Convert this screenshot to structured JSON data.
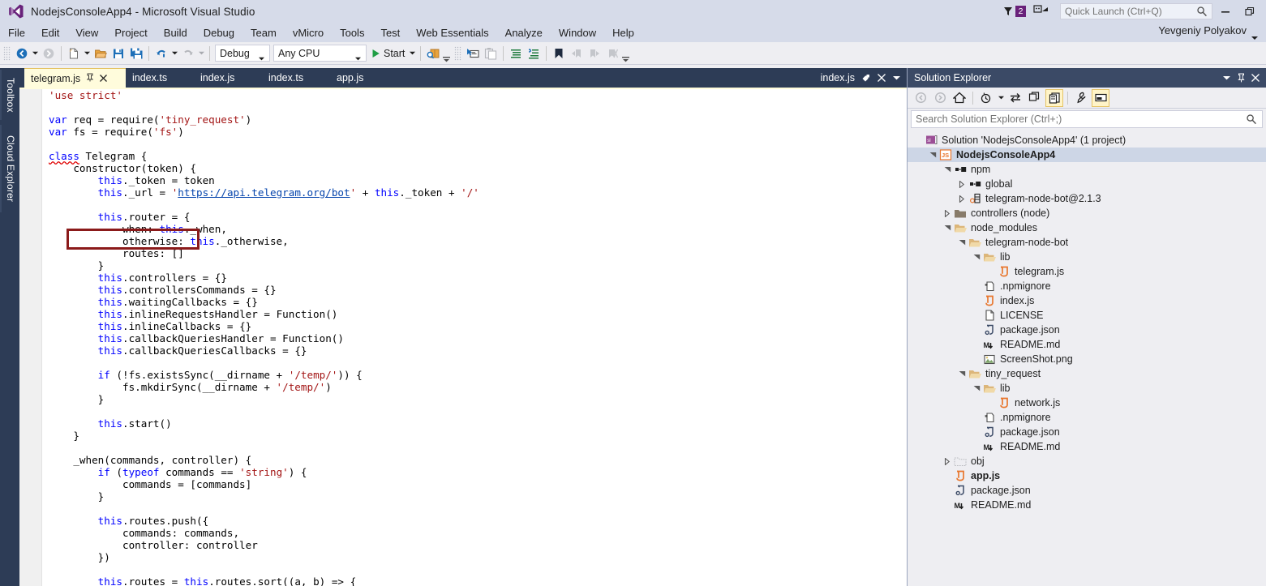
{
  "window": {
    "title": "NodejsConsoleApp4 - Microsoft Visual Studio",
    "logo_icon": "visual-studio-logo",
    "minimize_label": "–",
    "restore_label": "❐",
    "notification_count": "2",
    "feedback_icon": "feedback-icon",
    "user": "Yevgeniy Polyakov"
  },
  "quick_launch": {
    "placeholder": "Quick Launch (Ctrl+Q)",
    "value": "",
    "icon": "search-icon"
  },
  "menu": {
    "items": [
      {
        "label": "File"
      },
      {
        "label": "Edit"
      },
      {
        "label": "View"
      },
      {
        "label": "Project"
      },
      {
        "label": "Build"
      },
      {
        "label": "Debug"
      },
      {
        "label": "Team"
      },
      {
        "label": "vMicro"
      },
      {
        "label": "Tools"
      },
      {
        "label": "Test"
      },
      {
        "label": "Web Essentials"
      },
      {
        "label": "Analyze"
      },
      {
        "label": "Window"
      },
      {
        "label": "Help"
      }
    ]
  },
  "toolbar": {
    "navigate_back": "navigate-back-icon",
    "navigate_forward": "navigate-forward-icon",
    "new_project": "new-project-icon",
    "open_file": "open-file-icon",
    "save": "save-icon",
    "save_all": "save-all-icon",
    "undo": "undo-icon",
    "redo": "redo-icon",
    "config_value": "Debug",
    "platform_value": "Any CPU",
    "start_label": "Start",
    "start_icon": "play-icon",
    "find_in_files": "find-in-files-icon",
    "step_icons": [
      "step-over-icon",
      "step-out-icon"
    ],
    "comment": "comment-icon",
    "uncomment": "uncomment-icon",
    "bookmark": "bookmark-icon",
    "prev_bookmark": "previous-bookmark-icon",
    "next_bookmark": "next-bookmark-icon",
    "clear_bookmarks": "clear-bookmarks-icon",
    "overflow": "toolbar-overflow-icon"
  },
  "left_rail": {
    "tabs": [
      {
        "label": "Toolbox"
      },
      {
        "label": "Cloud Explorer"
      }
    ]
  },
  "editor_tabs": {
    "tabs": [
      {
        "label": "telegram.js",
        "active": true,
        "pin_icon": "pin-icon",
        "close_icon": "close-icon"
      },
      {
        "label": "index.ts",
        "active": false
      },
      {
        "label": "index.js",
        "active": false
      },
      {
        "label": "index.ts",
        "active": false
      },
      {
        "label": "app.js",
        "active": false
      }
    ],
    "right": {
      "label": "index.js",
      "pin_icon": "pin-icon",
      "close_icon": "close-icon",
      "dropdown_icon": "chevron-down-icon"
    }
  },
  "editor": {
    "filename": "telegram.js",
    "annotation": {
      "shape": "rectangle",
      "color": "#8b1a1a",
      "targets": "class Telegram {"
    },
    "error_marker_color": "#f21d1d",
    "lines": [
      "'use strict'",
      "",
      "var req = require('tiny_request')",
      "var fs = require('fs')",
      "",
      "class Telegram {",
      "    constructor(token) {",
      "        this._token = token",
      "        this._url = 'https://api.telegram.org/bot' + this._token + '/'",
      "",
      "        this.router = {",
      "            when: this._when,",
      "            otherwise: this._otherwise,",
      "            routes: []",
      "        }",
      "        this.controllers = {}",
      "        this.controllersCommands = {}",
      "        this.waitingCallbacks = {}",
      "        this.inlineRequestsHandler = Function()",
      "        this.inlineCallbacks = {}",
      "        this.callbackQueriesHandler = Function()",
      "        this.callbackQueriesCallbacks = {}",
      "",
      "        if (!fs.existsSync(__dirname + '/temp/')) {",
      "            fs.mkdirSync(__dirname + '/temp/')",
      "        }",
      "",
      "        this.start()",
      "    }",
      "",
      "    _when(commands, controller) {",
      "        if (typeof commands == 'string') {",
      "            commands = [commands]",
      "        }",
      "",
      "        this.routes.push({",
      "            commands: commands,",
      "            controller: controller",
      "        })",
      "",
      "        this.routes = this.routes.sort((a, b) => {"
    ]
  },
  "solution_explorer": {
    "title": "Solution Explorer",
    "header_buttons": [
      {
        "icon": "chevron-down-icon",
        "glyph": "▾"
      },
      {
        "icon": "pin-icon",
        "glyph": "⚑"
      },
      {
        "icon": "close-icon",
        "glyph": "✕"
      }
    ],
    "toolbar": [
      {
        "icon": "back-icon",
        "toggled": false
      },
      {
        "icon": "forward-icon",
        "toggled": false
      },
      {
        "icon": "home-icon",
        "toggled": false
      },
      {
        "icon": "pending-changes-icon",
        "toggled": false
      },
      {
        "icon": "sync-with-active-document-icon",
        "toggled": false
      },
      {
        "icon": "refresh-icon",
        "toggled": false
      },
      {
        "icon": "show-all-files-icon",
        "toggled": true
      },
      {
        "icon": "properties-icon",
        "toggled": false
      },
      {
        "icon": "preview-selected-items-icon",
        "toggled": true
      }
    ],
    "search": {
      "placeholder": "Search Solution Explorer (Ctrl+;)",
      "value": "",
      "icon": "search-icon"
    },
    "tree": [
      {
        "depth": 0,
        "label": "Solution 'NodejsConsoleApp4' (1 project)",
        "icon": "solution-icon",
        "expander": "none",
        "selected": false,
        "bold": false
      },
      {
        "depth": 1,
        "label": "NodejsConsoleApp4",
        "icon": "js-project-icon",
        "expander": "expanded",
        "selected": true,
        "bold": true
      },
      {
        "depth": 2,
        "label": "npm",
        "icon": "npm-icon",
        "expander": "expanded",
        "selected": false,
        "bold": false
      },
      {
        "depth": 3,
        "label": "global",
        "icon": "npm-icon",
        "expander": "collapsed",
        "selected": false,
        "bold": false
      },
      {
        "depth": 3,
        "label": "telegram-node-bot@2.1.3",
        "icon": "npm-package-icon",
        "expander": "collapsed",
        "selected": false,
        "bold": false
      },
      {
        "depth": 2,
        "label": "controllers (node)",
        "icon": "folder-closed-icon",
        "expander": "collapsed",
        "selected": false,
        "bold": false
      },
      {
        "depth": 2,
        "label": "node_modules",
        "icon": "folder-open-icon",
        "expander": "expanded",
        "selected": false,
        "bold": false
      },
      {
        "depth": 3,
        "label": "telegram-node-bot",
        "icon": "folder-open-icon",
        "expander": "expanded",
        "selected": false,
        "bold": false
      },
      {
        "depth": 4,
        "label": "lib",
        "icon": "folder-open-icon",
        "expander": "expanded",
        "selected": false,
        "bold": false
      },
      {
        "depth": 5,
        "label": "telegram.js",
        "icon": "js-file-icon",
        "expander": "none",
        "selected": false,
        "bold": false
      },
      {
        "depth": 4,
        "label": ".npmignore",
        "icon": "config-file-icon",
        "expander": "none",
        "selected": false,
        "bold": false
      },
      {
        "depth": 4,
        "label": "index.js",
        "icon": "js-file-icon",
        "expander": "none",
        "selected": false,
        "bold": false
      },
      {
        "depth": 4,
        "label": "LICENSE",
        "icon": "text-file-icon",
        "expander": "none",
        "selected": false,
        "bold": false
      },
      {
        "depth": 4,
        "label": "package.json",
        "icon": "json-file-icon",
        "expander": "none",
        "selected": false,
        "bold": false
      },
      {
        "depth": 4,
        "label": "README.md",
        "icon": "markdown-file-icon",
        "expander": "none",
        "selected": false,
        "bold": false
      },
      {
        "depth": 4,
        "label": "ScreenShot.png",
        "icon": "image-file-icon",
        "expander": "none",
        "selected": false,
        "bold": false
      },
      {
        "depth": 3,
        "label": "tiny_request",
        "icon": "folder-open-icon",
        "expander": "expanded",
        "selected": false,
        "bold": false
      },
      {
        "depth": 4,
        "label": "lib",
        "icon": "folder-open-icon",
        "expander": "expanded",
        "selected": false,
        "bold": false
      },
      {
        "depth": 5,
        "label": "network.js",
        "icon": "js-file-icon",
        "expander": "none",
        "selected": false,
        "bold": false
      },
      {
        "depth": 4,
        "label": ".npmignore",
        "icon": "config-file-icon",
        "expander": "none",
        "selected": false,
        "bold": false
      },
      {
        "depth": 4,
        "label": "package.json",
        "icon": "json-file-icon",
        "expander": "none",
        "selected": false,
        "bold": false
      },
      {
        "depth": 4,
        "label": "README.md",
        "icon": "markdown-file-icon",
        "expander": "none",
        "selected": false,
        "bold": false
      },
      {
        "depth": 2,
        "label": "obj",
        "icon": "hidden-folder-icon",
        "expander": "collapsed",
        "selected": false,
        "bold": false
      },
      {
        "depth": 2,
        "label": "app.js",
        "icon": "js-file-icon",
        "expander": "none",
        "selected": false,
        "bold": true
      },
      {
        "depth": 2,
        "label": "package.json",
        "icon": "json-file-icon",
        "expander": "none",
        "selected": false,
        "bold": false
      },
      {
        "depth": 2,
        "label": "README.md",
        "icon": "markdown-file-icon",
        "expander": "none",
        "selected": false,
        "bold": false
      }
    ]
  },
  "colors": {
    "titlebar": "#d6dbe9",
    "toolbar": "#eeeef2",
    "tab_strip": "#2d3c56",
    "active_tab": "#fffcdc",
    "panel_header": "#3b4a66",
    "accent_purple": "#68217a",
    "error_red": "#f21d1d",
    "annotation_red": "#8b1a1a",
    "keyword_blue": "#0000ff",
    "string_red": "#a31515",
    "link_blue": "#0645ad"
  }
}
